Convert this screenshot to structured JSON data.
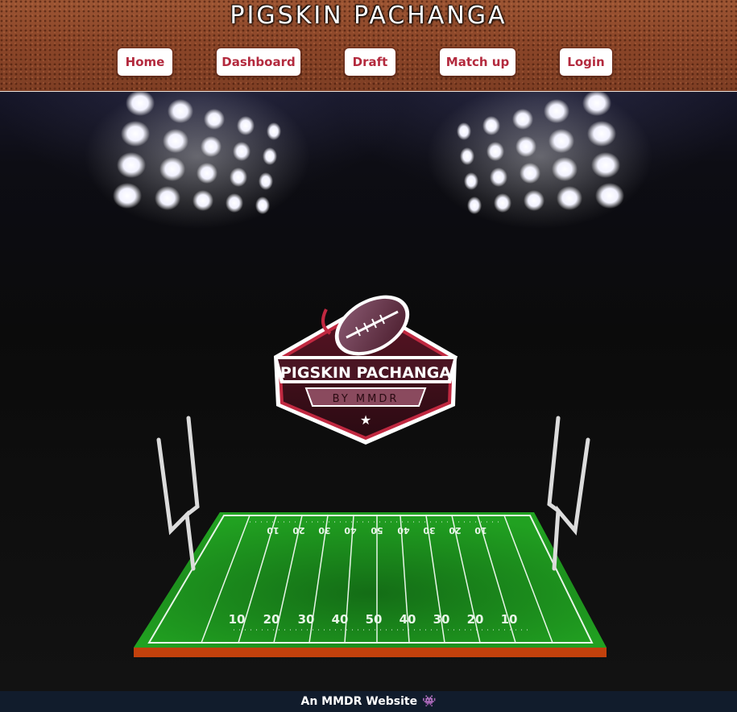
{
  "header": {
    "title": "PIGSKIN PACHANGA",
    "nav": [
      {
        "label": "Home"
      },
      {
        "label": "Dashboard"
      },
      {
        "label": "Draft"
      },
      {
        "label": "Match up"
      },
      {
        "label": "Login"
      }
    ]
  },
  "logo": {
    "title": "PIGSKIN PACHANGA",
    "subtitle": "BY MMDR"
  },
  "field": {
    "far_yard_numbers": [
      "10",
      "20",
      "30",
      "40",
      "50",
      "40",
      "30",
      "20",
      "10"
    ],
    "near_yard_numbers": [
      "10",
      "20",
      "30",
      "40",
      "50",
      "40",
      "30",
      "20",
      "10"
    ]
  },
  "footer": {
    "text": "An MMDR Website",
    "icon": "alien-icon"
  },
  "colors": {
    "accent": "#b32a3e",
    "field_green": "#1f9a1f",
    "footer_bg": "#111c2c"
  }
}
